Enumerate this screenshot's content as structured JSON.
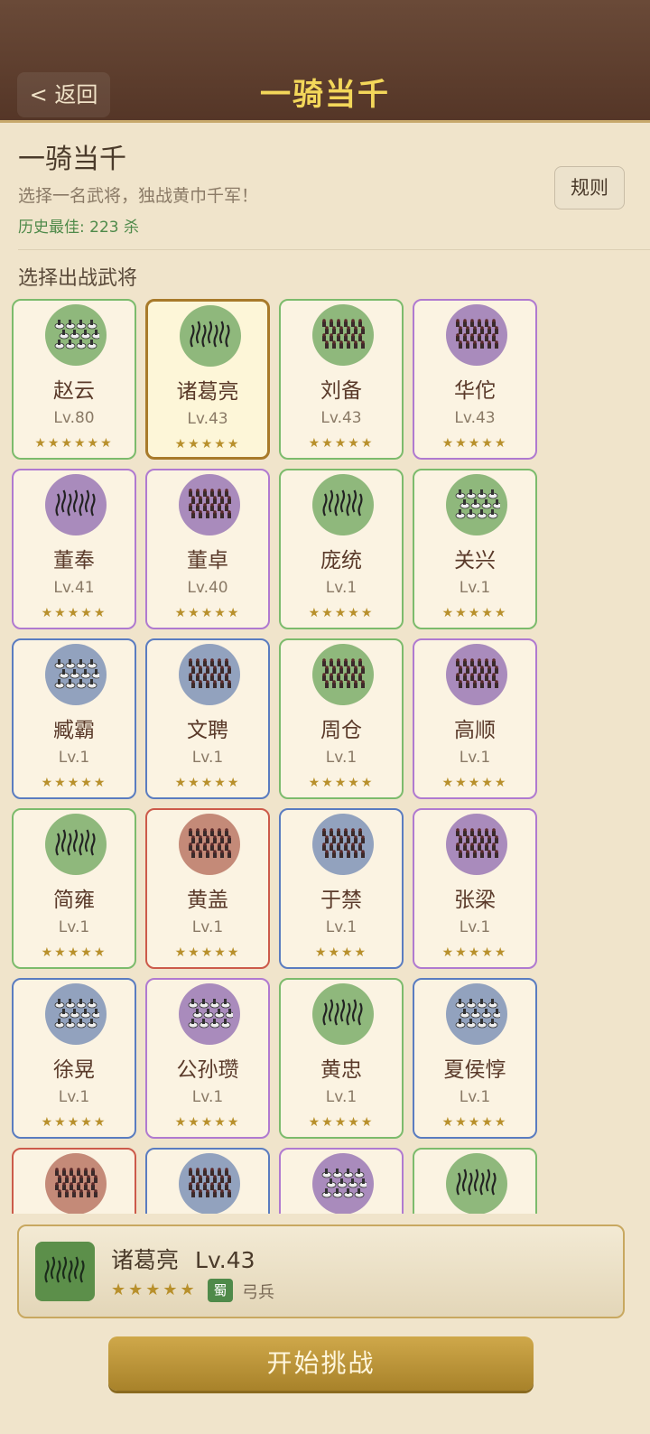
{
  "header": {
    "back_label": "< 返回",
    "title": "一骑当千"
  },
  "info": {
    "title": "一骑当千",
    "subtitle": "选择一名武将，独战黄巾千军！",
    "best": "历史最佳: 223 杀",
    "rules_label": "规则"
  },
  "section_label": "选择出战武将",
  "colors": {
    "green": "#7cbb6c",
    "purple": "#b07ad0",
    "blue": "#5a7cc0",
    "red": "#cc5a4a",
    "gold": "#b8902c"
  },
  "generals": [
    {
      "name": "赵云",
      "level": "Lv.80",
      "stars": "★★★★★★",
      "rarity": "green",
      "troop": "cavalry",
      "selected": false
    },
    {
      "name": "诸葛亮",
      "level": "Lv.43",
      "stars": "★★★★★",
      "rarity": "gold",
      "troop": "archer",
      "selected": true
    },
    {
      "name": "刘备",
      "level": "Lv.43",
      "stars": "★★★★★",
      "rarity": "green",
      "troop": "infantry",
      "selected": false
    },
    {
      "name": "华佗",
      "level": "Lv.43",
      "stars": "★★★★★",
      "rarity": "purple",
      "troop": "infantry",
      "selected": false
    },
    {
      "name": "董奉",
      "level": "Lv.41",
      "stars": "★★★★★",
      "rarity": "purple",
      "troop": "archer",
      "selected": false
    },
    {
      "name": "董卓",
      "level": "Lv.40",
      "stars": "★★★★★",
      "rarity": "purple",
      "troop": "infantry",
      "selected": false
    },
    {
      "name": "庞统",
      "level": "Lv.1",
      "stars": "★★★★★",
      "rarity": "green",
      "troop": "archer",
      "selected": false
    },
    {
      "name": "关兴",
      "level": "Lv.1",
      "stars": "★★★★★",
      "rarity": "green",
      "troop": "cavalry",
      "selected": false
    },
    {
      "name": "臧霸",
      "level": "Lv.1",
      "stars": "★★★★★",
      "rarity": "blue",
      "troop": "cavalry",
      "selected": false
    },
    {
      "name": "文聘",
      "level": "Lv.1",
      "stars": "★★★★★",
      "rarity": "blue",
      "troop": "infantry",
      "selected": false
    },
    {
      "name": "周仓",
      "level": "Lv.1",
      "stars": "★★★★★",
      "rarity": "green",
      "troop": "infantry",
      "selected": false
    },
    {
      "name": "高顺",
      "level": "Lv.1",
      "stars": "★★★★★",
      "rarity": "purple",
      "troop": "infantry",
      "selected": false
    },
    {
      "name": "简雍",
      "level": "Lv.1",
      "stars": "★★★★★",
      "rarity": "green",
      "troop": "archer",
      "selected": false
    },
    {
      "name": "黄盖",
      "level": "Lv.1",
      "stars": "★★★★★",
      "rarity": "red",
      "troop": "infantry",
      "selected": false
    },
    {
      "name": "于禁",
      "level": "Lv.1",
      "stars": "★★★★",
      "rarity": "blue",
      "troop": "infantry",
      "selected": false
    },
    {
      "name": "张梁",
      "level": "Lv.1",
      "stars": "★★★★★",
      "rarity": "purple",
      "troop": "infantry",
      "selected": false
    },
    {
      "name": "徐晃",
      "level": "Lv.1",
      "stars": "★★★★★",
      "rarity": "blue",
      "troop": "cavalry",
      "selected": false
    },
    {
      "name": "公孙瓒",
      "level": "Lv.1",
      "stars": "★★★★★",
      "rarity": "purple",
      "troop": "cavalry",
      "selected": false
    },
    {
      "name": "黄忠",
      "level": "Lv.1",
      "stars": "★★★★★",
      "rarity": "green",
      "troop": "archer",
      "selected": false
    },
    {
      "name": "夏侯惇",
      "level": "Lv.1",
      "stars": "★★★★★",
      "rarity": "blue",
      "troop": "cavalry",
      "selected": false
    },
    {
      "name": "",
      "level": "",
      "stars": "",
      "rarity": "red",
      "troop": "infantry",
      "selected": false
    },
    {
      "name": "",
      "level": "",
      "stars": "",
      "rarity": "blue",
      "troop": "infantry",
      "selected": false
    },
    {
      "name": "",
      "level": "",
      "stars": "",
      "rarity": "purple",
      "troop": "cavalry",
      "selected": false
    },
    {
      "name": "",
      "level": "",
      "stars": "",
      "rarity": "green",
      "troop": "archer",
      "selected": false
    }
  ],
  "selected": {
    "name": "诸葛亮",
    "level": "Lv.43",
    "stars": "★★★★★",
    "faction": "蜀",
    "troop_type": "弓兵"
  },
  "start_label": "开始挑战"
}
